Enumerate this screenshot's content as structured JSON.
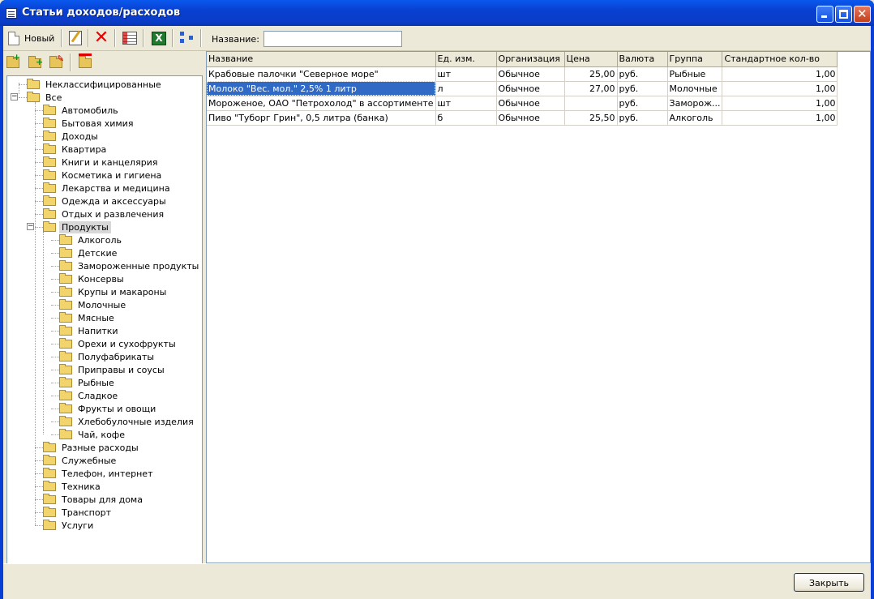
{
  "window": {
    "title": "Статьи доходов/расходов"
  },
  "toolbar": {
    "new_label": "Новый",
    "name_label": "Название:",
    "name_value": ""
  },
  "tree": {
    "top_items": [
      "Неклассифицированные",
      "Все"
    ],
    "all_children": [
      "Автомобиль",
      "Бытовая химия",
      "Доходы",
      "Квартира",
      "Книги и канцелярия",
      "Косметика и гигиена",
      "Лекарства и медицина",
      "Одежда и аксессуары",
      "Отдых и развлечения",
      "Продукты"
    ],
    "products_children": [
      "Алкоголь",
      "Детские",
      "Замороженные продукты",
      "Консервы",
      "Крупы и макароны",
      "Молочные",
      "Мясные",
      "Напитки",
      "Орехи и сухофрукты",
      "Полуфабрикаты",
      "Приправы и соусы",
      "Рыбные",
      "Сладкое",
      "Фрукты и овощи",
      "Хлебобулочные изделия",
      "Чай, кофе"
    ],
    "after_children": [
      "Разные расходы",
      "Служебные",
      "Телефон, интернет",
      "Техника",
      "Товары для дома",
      "Транспорт",
      "Услуги"
    ],
    "selected": "Продукты"
  },
  "grid": {
    "columns": [
      "Название",
      "Ед. изм.",
      "Организация",
      "Цена",
      "Валюта",
      "Группа",
      "Стандартное кол-во"
    ],
    "rows": [
      [
        "Крабовые палочки \"Северное море\"",
        "шт",
        "Обычное",
        "25,00",
        "руб.",
        "Рыбные",
        "1,00"
      ],
      [
        "Молоко \"Вес. мол.\" 2,5% 1 литр",
        "л",
        "Обычное",
        "27,00",
        "руб.",
        "Молочные",
        "1,00"
      ],
      [
        "Мороженое, ОАО \"Петрохолод\" в ассортименте",
        "шт",
        "Обычное",
        "",
        "руб.",
        "Заморож...",
        "1,00"
      ],
      [
        "Пиво \"Туборг Грин\", 0,5 литра (банка)",
        "б",
        "Обычное",
        "25,50",
        "руб.",
        "Алкоголь",
        "1,00"
      ]
    ],
    "selected_row": 1
  },
  "footer": {
    "close_label": "Закрыть"
  }
}
